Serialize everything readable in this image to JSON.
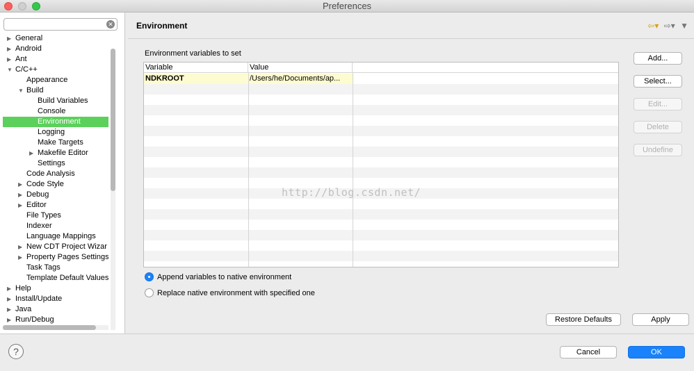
{
  "window": {
    "title": "Preferences"
  },
  "sidebar": {
    "filter_value": "",
    "tree": [
      {
        "label": "General",
        "level": 0,
        "arrow": "right"
      },
      {
        "label": "Android",
        "level": 0,
        "arrow": "right"
      },
      {
        "label": "Ant",
        "level": 0,
        "arrow": "right"
      },
      {
        "label": "C/C++",
        "level": 0,
        "arrow": "down"
      },
      {
        "label": "Appearance",
        "level": 1,
        "arrow": ""
      },
      {
        "label": "Build",
        "level": 1,
        "arrow": "down"
      },
      {
        "label": "Build Variables",
        "level": 2,
        "arrow": ""
      },
      {
        "label": "Console",
        "level": 2,
        "arrow": ""
      },
      {
        "label": "Environment",
        "level": 2,
        "arrow": "",
        "selected": true
      },
      {
        "label": "Logging",
        "level": 2,
        "arrow": ""
      },
      {
        "label": "Make Targets",
        "level": 2,
        "arrow": ""
      },
      {
        "label": "Makefile Editor",
        "level": 2,
        "arrow": "right"
      },
      {
        "label": "Settings",
        "level": 2,
        "arrow": ""
      },
      {
        "label": "Code Analysis",
        "level": 1,
        "arrow": ""
      },
      {
        "label": "Code Style",
        "level": 1,
        "arrow": "right"
      },
      {
        "label": "Debug",
        "level": 1,
        "arrow": "right"
      },
      {
        "label": "Editor",
        "level": 1,
        "arrow": "right"
      },
      {
        "label": "File Types",
        "level": 1,
        "arrow": ""
      },
      {
        "label": "Indexer",
        "level": 1,
        "arrow": ""
      },
      {
        "label": "Language Mappings",
        "level": 1,
        "arrow": ""
      },
      {
        "label": "New CDT Project Wizar",
        "level": 1,
        "arrow": "right"
      },
      {
        "label": "Property Pages Settings",
        "level": 1,
        "arrow": "right"
      },
      {
        "label": "Task Tags",
        "level": 1,
        "arrow": ""
      },
      {
        "label": "Template Default Values",
        "level": 1,
        "arrow": ""
      },
      {
        "label": "Help",
        "level": 0,
        "arrow": "right"
      },
      {
        "label": "Install/Update",
        "level": 0,
        "arrow": "right"
      },
      {
        "label": "Java",
        "level": 0,
        "arrow": "right"
      },
      {
        "label": "Run/Debug",
        "level": 0,
        "arrow": "right"
      }
    ]
  },
  "page": {
    "title": "Environment",
    "env_label": "Environment variables to set",
    "columns": [
      "Variable",
      "Value"
    ],
    "rows": [
      {
        "variable": "NDKROOT",
        "value": "/Users/he/Documents/ap..."
      }
    ],
    "empty_rows": 17,
    "watermark": "http://blog.csdn.net/",
    "buttons": {
      "add": "Add...",
      "select": "Select...",
      "edit": "Edit...",
      "delete": "Delete",
      "undefine": "Undefine"
    },
    "radios": {
      "append": "Append variables to native environment",
      "replace": "Replace native environment with specified one"
    },
    "restore_defaults": "Restore Defaults",
    "apply": "Apply"
  },
  "footer": {
    "help": "?",
    "cancel": "Cancel",
    "ok": "OK"
  },
  "colors": {
    "selection_green": "#5bd05b",
    "primary_blue": "#1a82fb",
    "row_highlight": "#fdfbd0"
  }
}
